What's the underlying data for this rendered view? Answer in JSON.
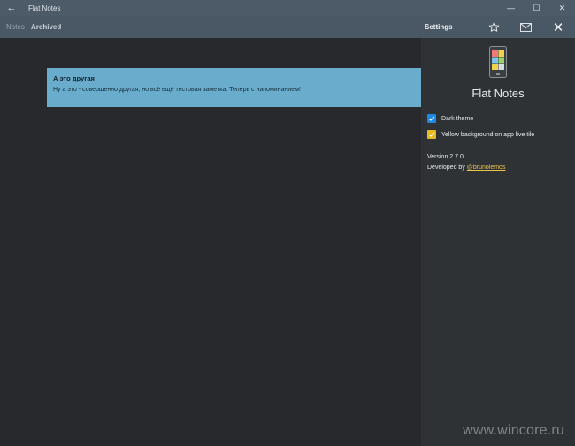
{
  "window": {
    "title": "Flat Notes",
    "back_glyph": "←",
    "minimize_glyph": "—",
    "maximize_glyph": "☐",
    "close_glyph": "✕"
  },
  "header": {
    "tabs": [
      {
        "label": "Notes",
        "active": false
      },
      {
        "label": "Archived",
        "active": true
      }
    ],
    "settings_title": "Settings",
    "star_icon": "star-icon",
    "mail_icon": "mail-icon",
    "close_glyph": "✕"
  },
  "note": {
    "title": "А это другая",
    "body": "Ну а это - совершенно другая, но всё ещё тестовая заметка. Теперь с напоминанием!",
    "color": "#6aaccc"
  },
  "settings": {
    "app_name": "Flat Notes",
    "options": [
      {
        "label": "Dark theme",
        "checked": true,
        "color": "#1e88e5"
      },
      {
        "label": "Yellow background on app live tile",
        "checked": true,
        "color": "#e8b923"
      }
    ],
    "version": "Version 2.7.0",
    "developed_prefix": "Developed by ",
    "developer_link": "@brunolemos",
    "link_color": "#e8c24a"
  },
  "watermark": "www.wincore.ru"
}
